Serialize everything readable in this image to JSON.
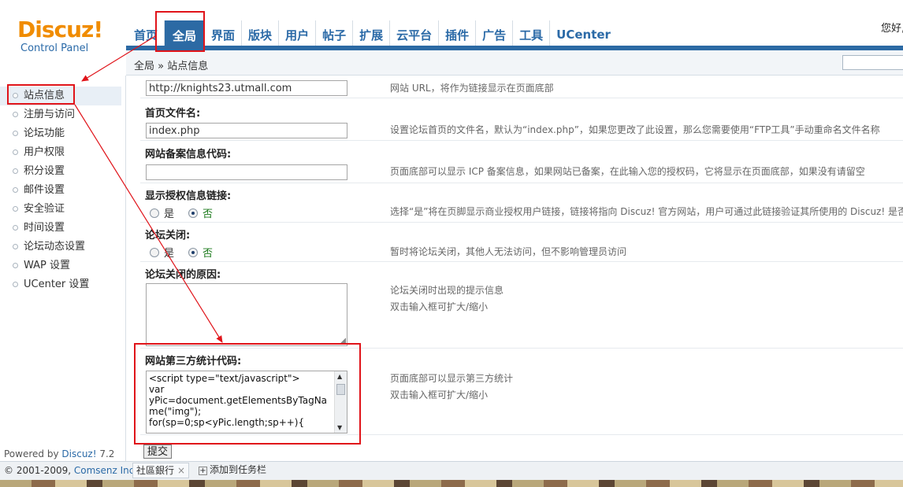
{
  "header": {
    "logo_text": "Discuz!",
    "logo_subtitle": "Control Panel",
    "greeting": "您好,",
    "nav": [
      {
        "label": "首页",
        "active": false
      },
      {
        "label": "全局",
        "active": true
      },
      {
        "label": "界面",
        "active": false
      },
      {
        "label": "版块",
        "active": false
      },
      {
        "label": "用户",
        "active": false
      },
      {
        "label": "帖子",
        "active": false
      },
      {
        "label": "扩展",
        "active": false
      },
      {
        "label": "云平台",
        "active": false
      },
      {
        "label": "插件",
        "active": false
      },
      {
        "label": "广告",
        "active": false
      },
      {
        "label": "工具",
        "active": false
      },
      {
        "label": "UCenter",
        "active": false
      }
    ]
  },
  "breadcrumb": "全局 » 站点信息",
  "sidebar": {
    "items": [
      {
        "label": "站点信息",
        "active": true
      },
      {
        "label": "注册与访问",
        "active": false
      },
      {
        "label": "论坛功能",
        "active": false
      },
      {
        "label": "用户权限",
        "active": false
      },
      {
        "label": "积分设置",
        "active": false
      },
      {
        "label": "邮件设置",
        "active": false
      },
      {
        "label": "安全验证",
        "active": false
      },
      {
        "label": "时间设置",
        "active": false
      },
      {
        "label": "论坛动态设置",
        "active": false
      },
      {
        "label": "WAP 设置",
        "active": false
      },
      {
        "label": "UCenter 设置",
        "active": false
      }
    ],
    "powered_by": "Powered by",
    "powered_brand": "Discuz!",
    "powered_version": "7.2"
  },
  "form": {
    "site_url": {
      "value": "http://knights23.utmall.com",
      "tip": "网站 URL，将作为链接显示在页面底部"
    },
    "index_file": {
      "title": "首页文件名:",
      "value": "index.php",
      "tip": "设置论坛首页的文件名，默认为“index.php”，如果您更改了此设置，那么您需要使用“FTP工具”手动重命名文件名称"
    },
    "icp": {
      "title": "网站备案信息代码:",
      "value": "",
      "tip": "页面底部可以显示 ICP 备案信息，如果网站已备案，在此输入您的授权码，它将显示在页面底部，如果没有请留空"
    },
    "license_link": {
      "title": "显示授权信息链接:",
      "yes": "是",
      "no": "否",
      "selected": "否",
      "tip": "选择“是”将在页脚显示商业授权用户链接，链接将指向 Discuz! 官方网站，用户可通过此链接验证其所使用的 Discuz! 是否"
    },
    "forum_closed": {
      "title": "论坛关闭:",
      "yes": "是",
      "no": "否",
      "selected": "否",
      "tip": "暂时将论坛关闭，其他人无法访问，但不影响管理员访问"
    },
    "close_reason": {
      "title": "论坛关闭的原因:",
      "value": "",
      "tip1": "论坛关闭时出现的提示信息",
      "tip2": "双击输入框可扩大/缩小"
    },
    "stats_code": {
      "title": "网站第三方统计代码:",
      "value": "<script type=\"text/javascript\">\nvar\nyPic=document.getElementsByTagName(\"img\");\nfor(sp=0;sp<yPic.length;sp++){",
      "tip1": "页面底部可以显示第三方统计",
      "tip2": "双击输入框可扩大/缩小"
    },
    "submit_label": "提交"
  },
  "footer": {
    "copyright_prefix": "© 2001-2009,",
    "copyright_brand": "Comsenz Inc.",
    "taskbar_tab": "社區銀行",
    "taskbar_close": "×",
    "taskbar_add": "添加到任务栏"
  },
  "colors": {
    "accent_blue": "#2c6aa4",
    "logo_orange": "#f08c00",
    "annotation_red": "#e0141a"
  }
}
